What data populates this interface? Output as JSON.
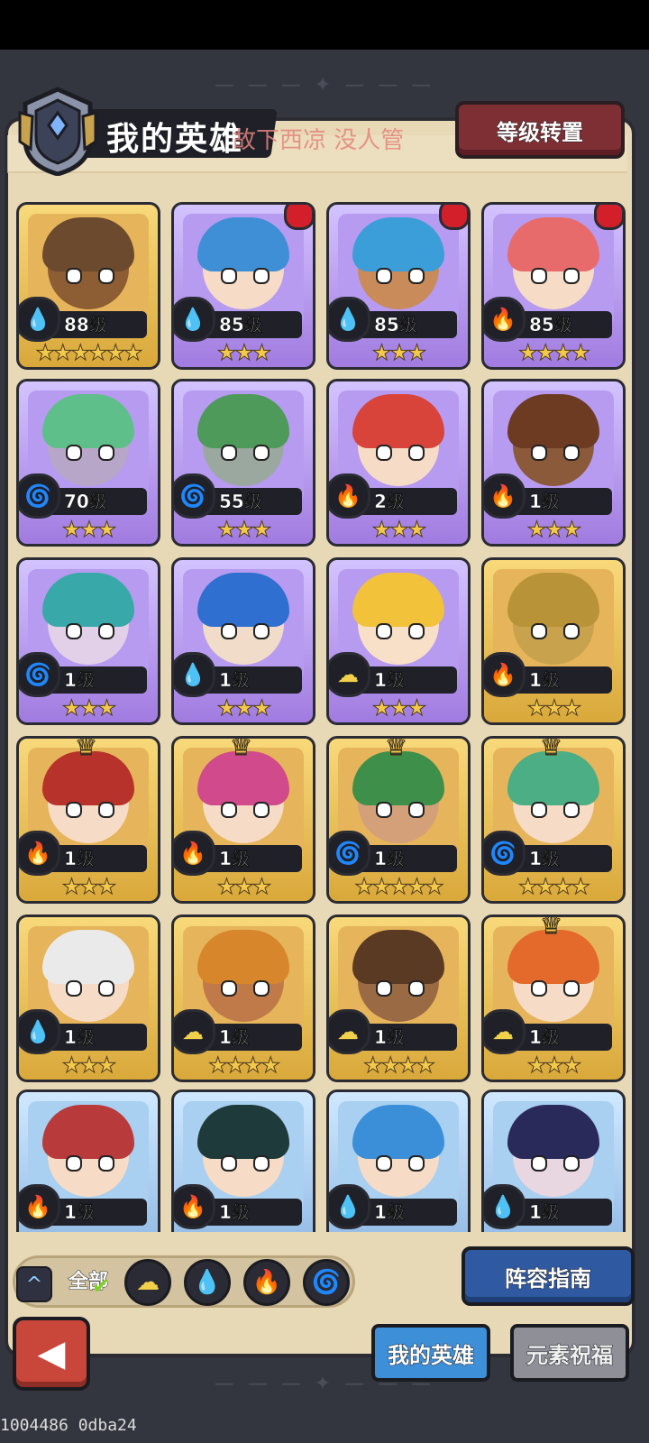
{
  "header": {
    "title": "我的英雄",
    "overlay_text": "故下西凉 没人管",
    "level_transfer_button": "等级转置"
  },
  "element_icons": {
    "water": "💧",
    "fire": "🔥",
    "nature": "🌀",
    "earth": "☁"
  },
  "heroes": [
    {
      "level": "88级",
      "element": "water",
      "stars": "★★★★★★",
      "rarity": "gold",
      "red_dot": false,
      "crown": false
    },
    {
      "level": "85级",
      "element": "water",
      "stars": "★★★",
      "rarity": "purple",
      "red_dot": true,
      "crown": false
    },
    {
      "level": "85级",
      "element": "water",
      "stars": "★★★",
      "rarity": "purple",
      "red_dot": true,
      "crown": false
    },
    {
      "level": "85级",
      "element": "fire",
      "stars": "★★★★",
      "rarity": "purple",
      "red_dot": true,
      "crown": false
    },
    {
      "level": "70级",
      "element": "nature",
      "stars": "★★★",
      "rarity": "purple",
      "red_dot": false,
      "crown": false
    },
    {
      "level": "55级",
      "element": "nature",
      "stars": "★★★",
      "rarity": "purple",
      "red_dot": false,
      "crown": false
    },
    {
      "level": "2级",
      "element": "fire",
      "stars": "★★★",
      "rarity": "purple",
      "red_dot": false,
      "crown": false
    },
    {
      "level": "1级",
      "element": "fire",
      "stars": "★★★",
      "rarity": "purple",
      "red_dot": false,
      "crown": false
    },
    {
      "level": "1级",
      "element": "nature",
      "stars": "★★★",
      "rarity": "purple",
      "red_dot": false,
      "crown": false
    },
    {
      "level": "1级",
      "element": "water",
      "stars": "★★★",
      "rarity": "purple",
      "red_dot": false,
      "crown": false
    },
    {
      "level": "1级",
      "element": "earth",
      "stars": "★★★",
      "rarity": "purple",
      "red_dot": false,
      "crown": false
    },
    {
      "level": "1级",
      "element": "fire",
      "stars": "★★★",
      "rarity": "gold",
      "red_dot": false,
      "crown": false
    },
    {
      "level": "1级",
      "element": "fire",
      "stars": "★★★",
      "rarity": "gold",
      "red_dot": false,
      "crown": true
    },
    {
      "level": "1级",
      "element": "fire",
      "stars": "★★★",
      "rarity": "gold",
      "red_dot": false,
      "crown": true
    },
    {
      "level": "1级",
      "element": "nature",
      "stars": "★★★★★",
      "rarity": "gold",
      "red_dot": false,
      "crown": true
    },
    {
      "level": "1级",
      "element": "nature",
      "stars": "★★★★",
      "rarity": "gold",
      "red_dot": false,
      "crown": true
    },
    {
      "level": "1级",
      "element": "water",
      "stars": "★★★",
      "rarity": "gold",
      "red_dot": false,
      "crown": false
    },
    {
      "level": "1级",
      "element": "earth",
      "stars": "★★★★",
      "rarity": "gold",
      "red_dot": false,
      "crown": false
    },
    {
      "level": "1级",
      "element": "earth",
      "stars": "★★★★",
      "rarity": "gold",
      "red_dot": false,
      "crown": false
    },
    {
      "level": "1级",
      "element": "earth",
      "stars": "★★★",
      "rarity": "gold",
      "red_dot": false,
      "crown": true
    },
    {
      "level": "1级",
      "element": "fire",
      "stars": "",
      "rarity": "blue",
      "red_dot": false,
      "crown": false
    },
    {
      "level": "1级",
      "element": "fire",
      "stars": "",
      "rarity": "blue",
      "red_dot": false,
      "crown": false
    },
    {
      "level": "1级",
      "element": "water",
      "stars": "",
      "rarity": "blue",
      "red_dot": false,
      "crown": false
    },
    {
      "level": "1级",
      "element": "water",
      "stars": "",
      "rarity": "blue",
      "red_dot": false,
      "crown": false
    }
  ],
  "filters": {
    "toggle_icon": "^",
    "all_label": "全部",
    "elements": [
      "earth",
      "water",
      "fire",
      "nature"
    ]
  },
  "buttons": {
    "lineup_guide": "阵容指南",
    "back_icon": "◀"
  },
  "tabs": [
    {
      "label": "我的英雄",
      "active": true
    },
    {
      "label": "元素祝福",
      "active": false
    }
  ],
  "footer": {
    "debug_text": "1004486 0dba24"
  },
  "colors": {
    "accent_red": "#7e2f34",
    "accent_blue": "#2f5aa2",
    "panel": "#e7d8b6",
    "red_dot": "#d21f2a"
  }
}
